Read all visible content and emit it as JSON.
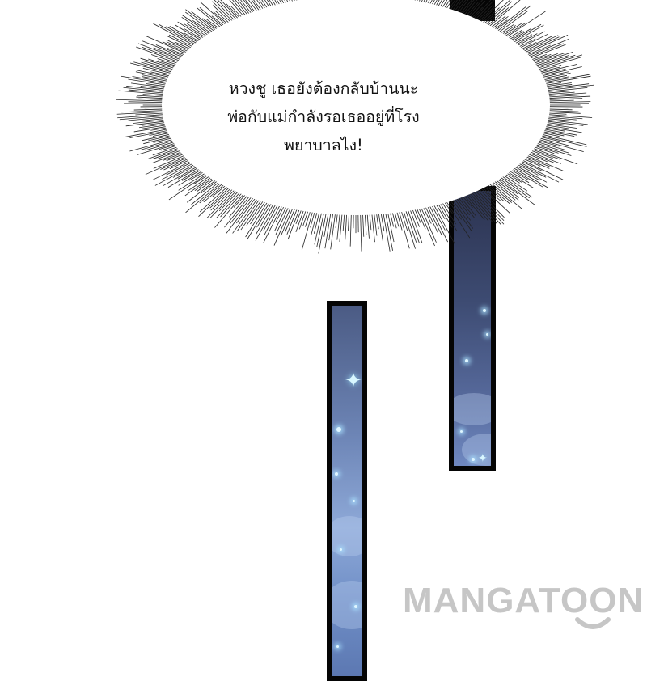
{
  "speech_bubble": {
    "lines": [
      "หวงชู เธอยังต้องกลับบ้านนะ",
      "พ่อกับแม่กำลังรอเธออยู่ที่โรง",
      "พยาบาลไง!"
    ]
  },
  "watermark": {
    "text": "MANGATOON",
    "icon": "smile-icon",
    "color": "#c6c6c6"
  },
  "colors": {
    "panel_border": "#050505",
    "sky_dark": "#2c3350",
    "sky_light": "#8ea9d8",
    "sparkle": "#dff6ff"
  }
}
